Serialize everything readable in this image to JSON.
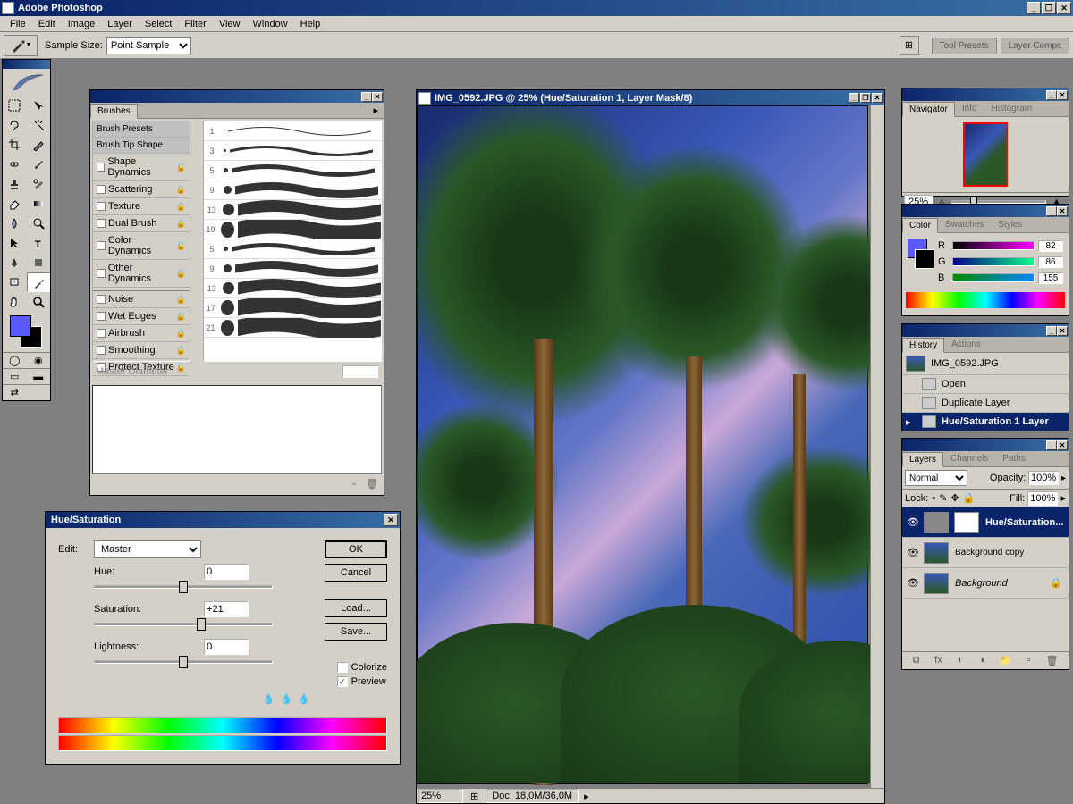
{
  "app": {
    "title": "Adobe Photoshop"
  },
  "menus": [
    "File",
    "Edit",
    "Image",
    "Layer",
    "Select",
    "Filter",
    "View",
    "Window",
    "Help"
  ],
  "optbar": {
    "sample_label": "Sample Size:",
    "sample_value": "Point Sample",
    "tabs": [
      "Tool Presets",
      "Layer Comps"
    ]
  },
  "toolbox_tools": [
    "marquee",
    "move",
    "lasso",
    "wand",
    "crop",
    "slice",
    "healing",
    "brush",
    "stamp",
    "history-brush",
    "eraser",
    "gradient",
    "blur",
    "dodge",
    "path-select",
    "type",
    "pen",
    "shape",
    "notes",
    "eyedropper",
    "hand",
    "zoom"
  ],
  "brushes": {
    "title": "Brushes",
    "presets_label": "Brush Presets",
    "tip_label": "Brush Tip Shape",
    "opts": [
      "Shape Dynamics",
      "Scattering",
      "Texture",
      "Dual Brush",
      "Color Dynamics",
      "Other Dynamics"
    ],
    "opts2": [
      "Noise",
      "Wet Edges",
      "Airbrush",
      "Smoothing",
      "Protect Texture"
    ],
    "sizes": [
      1,
      3,
      5,
      9,
      13,
      19,
      5,
      9,
      13,
      17,
      21
    ],
    "diameter_label": "Master Diameter"
  },
  "doc": {
    "title": "IMG_0592.JPG @ 25% (Hue/Saturation 1, Layer Mask/8)",
    "zoom": "25%",
    "info": "Doc: 18,0M/36,0M"
  },
  "huesat": {
    "title": "Hue/Saturation",
    "edit_label": "Edit:",
    "edit_value": "Master",
    "hue_label": "Hue:",
    "hue_value": "0",
    "sat_label": "Saturation:",
    "sat_value": "+21",
    "light_label": "Lightness:",
    "light_value": "0",
    "ok": "OK",
    "cancel": "Cancel",
    "load": "Load...",
    "save": "Save...",
    "colorize": "Colorize",
    "preview": "Preview"
  },
  "navigator": {
    "tabs": [
      "Navigator",
      "Info",
      "Histogram"
    ],
    "zoom": "25%"
  },
  "color": {
    "tabs": [
      "Color",
      "Swatches",
      "Styles"
    ],
    "r": "82",
    "g": "86",
    "b": "155"
  },
  "history": {
    "tabs": [
      "History",
      "Actions"
    ],
    "doc": "IMG_0592.JPG",
    "items": [
      "Open",
      "Duplicate Layer",
      "Hue/Saturation 1 Layer"
    ]
  },
  "layers": {
    "tabs": [
      "Layers",
      "Channels",
      "Paths"
    ],
    "blend": "Normal",
    "opacity_label": "Opacity:",
    "opacity": "100%",
    "lock_label": "Lock:",
    "fill_label": "Fill:",
    "fill": "100%",
    "items": [
      {
        "name": "Hue/Saturation...",
        "selected": true,
        "adj": true
      },
      {
        "name": "Background copy",
        "selected": false
      },
      {
        "name": "Background",
        "selected": false,
        "locked": true,
        "italic": true
      }
    ]
  }
}
